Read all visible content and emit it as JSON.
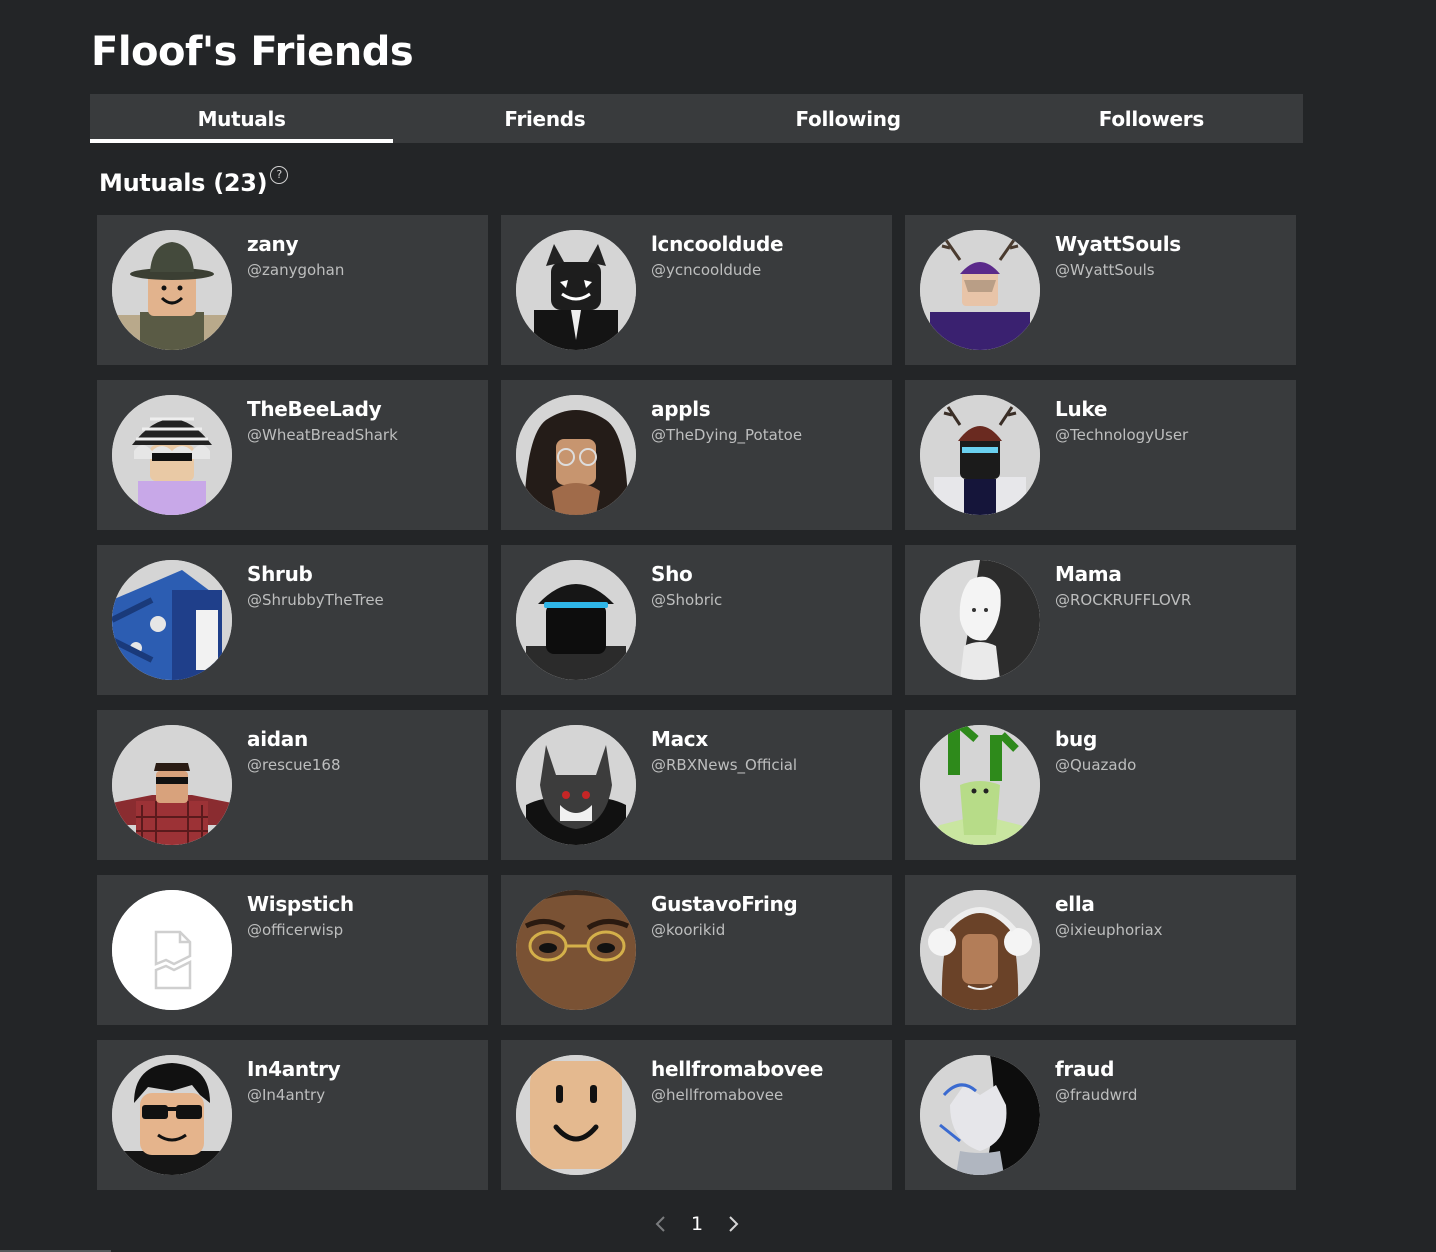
{
  "header": {
    "title": "Floof's Friends"
  },
  "tabs": [
    {
      "label": "Mutuals",
      "active": true
    },
    {
      "label": "Friends",
      "active": false
    },
    {
      "label": "Following",
      "active": false
    },
    {
      "label": "Followers",
      "active": false
    }
  ],
  "section": {
    "title": "Mutuals (23)",
    "help_icon": "?"
  },
  "friends": [
    {
      "display_name": "zany",
      "username": "@zanygohan",
      "avatar": "ranger-hat"
    },
    {
      "display_name": "lcncooldude",
      "username": "@ycncooldude",
      "avatar": "black-suit"
    },
    {
      "display_name": "WyattSouls",
      "username": "@WyattSouls",
      "avatar": "antlers-purple"
    },
    {
      "display_name": "TheBeeLady",
      "username": "@WheatBreadShark",
      "avatar": "striped-hat"
    },
    {
      "display_name": "appls",
      "username": "@TheDying_Potatoe",
      "avatar": "dark-hair-glasses"
    },
    {
      "display_name": "Luke",
      "username": "@TechnologyUser",
      "avatar": "antlers-visor"
    },
    {
      "display_name": "Shrub",
      "username": "@ShrubbyTheTree",
      "avatar": "blue-mech"
    },
    {
      "display_name": "Sho",
      "username": "@Shobric",
      "avatar": "black-cap-visor"
    },
    {
      "display_name": "Mama",
      "username": "@ROCKRUFFLOVR",
      "avatar": "white-monochrome"
    },
    {
      "display_name": "aidan",
      "username": "@rescue168",
      "avatar": "plaid-sunglasses"
    },
    {
      "display_name": "Macx",
      "username": "@RBXNews_Official",
      "avatar": "gray-fox"
    },
    {
      "display_name": "bug",
      "username": "@Quazado",
      "avatar": "green-bug"
    },
    {
      "display_name": "Wispstich",
      "username": "@officerwisp",
      "avatar": "placeholder"
    },
    {
      "display_name": "GustavoFring",
      "username": "@koorikid",
      "avatar": "closeup-glasses"
    },
    {
      "display_name": "ella",
      "username": "@ixieuphoriax",
      "avatar": "brown-hair-earmuffs"
    },
    {
      "display_name": "In4antry",
      "username": "@In4antry",
      "avatar": "black-hair-shades"
    },
    {
      "display_name": "hellfromabovee",
      "username": "@hellfromabovee",
      "avatar": "classic-smile"
    },
    {
      "display_name": "fraud",
      "username": "@fraudwrd",
      "avatar": "white-fox-split"
    }
  ],
  "pagination": {
    "current_page": "1",
    "prev_icon": "chevron-left-icon",
    "next_icon": "chevron-right-icon"
  }
}
